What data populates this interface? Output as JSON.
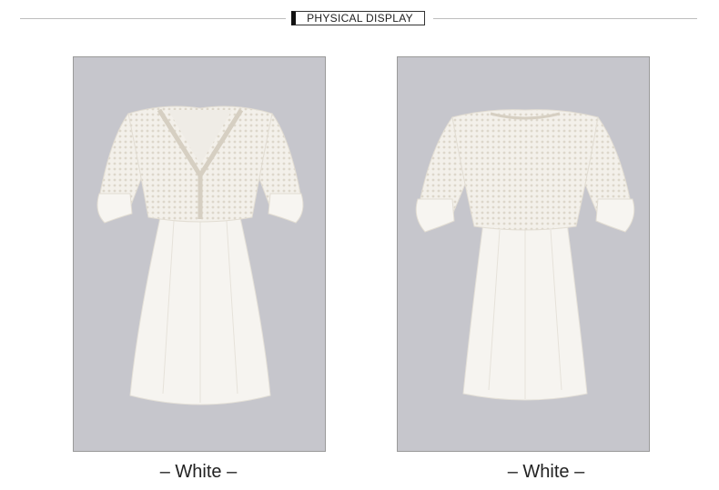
{
  "header": {
    "title": "PHYSICAL DISPLAY"
  },
  "panels": [
    {
      "view": "front",
      "caption": "– White –"
    },
    {
      "view": "back",
      "caption": "– White –"
    }
  ],
  "colors": {
    "panel_bg": "#c6c6cc",
    "dress": "#f5f3ef",
    "lace": "#e9e5dd"
  }
}
